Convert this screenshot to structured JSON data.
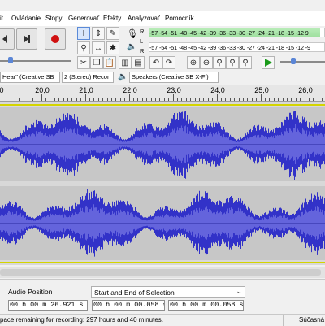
{
  "menu": [
    "it",
    "Ovládanie",
    "Stopy",
    "Generovať",
    "Efekty",
    "Analyzovať",
    "Pomocník"
  ],
  "meters": {
    "recording_label": "R",
    "playback_label": "L",
    "playback_label_2": "R",
    "recording_scale": "-57 -54 -51 -48 -45 -42 -39 -36 -33 -30 -27 -24 -21 -18 -15 -12   9",
    "playback_scale": "-57 -54 -51 -48 -45 -42 -39 -36 -33 -30 -27 -24 -21 -18 -15 -12 -9"
  },
  "devices": {
    "recording_device": "Hear\" (Creative SB",
    "channels": "2 (Stereo) Recor",
    "playback_device": "Speakers (Creative SB X-Fi)"
  },
  "ruler": {
    "labels": [
      "0",
      "20,0",
      "21,0",
      "22,0",
      "23,0",
      "24,0",
      "25,0",
      "26,0"
    ]
  },
  "selection_toolbar": {
    "audio_position_label": "Audio Position",
    "selection_mode": "Start and End of Selection",
    "audio_position": "00 h 00 m 26.921 s",
    "selection_start": "00 h 00 m 00.058 s",
    "selection_end": "00 h 00 m 00.058 s"
  },
  "status": {
    "left": "pace remaining for recording: 297 hours and 40 minutes.",
    "right": "Súčasná vzork"
  },
  "colors": {
    "waveform": "#3232c8",
    "waveform_rms": "#6464dc",
    "track_bg": "#c7c7c7",
    "selection_border": "#d4d400"
  }
}
